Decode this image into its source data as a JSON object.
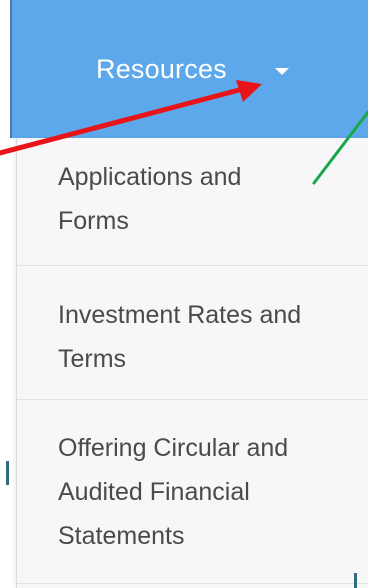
{
  "nav": {
    "label": "Resources"
  },
  "menu": {
    "items": [
      {
        "label": "Applications and\nForms"
      },
      {
        "label": "Investment Rates and\nTerms"
      },
      {
        "label": "Offering Circular and\nAudited Financial\nStatements"
      }
    ]
  },
  "annotations": {
    "red_arrow_color": "#e8141a",
    "green_arrow_color": "#17a84a"
  }
}
